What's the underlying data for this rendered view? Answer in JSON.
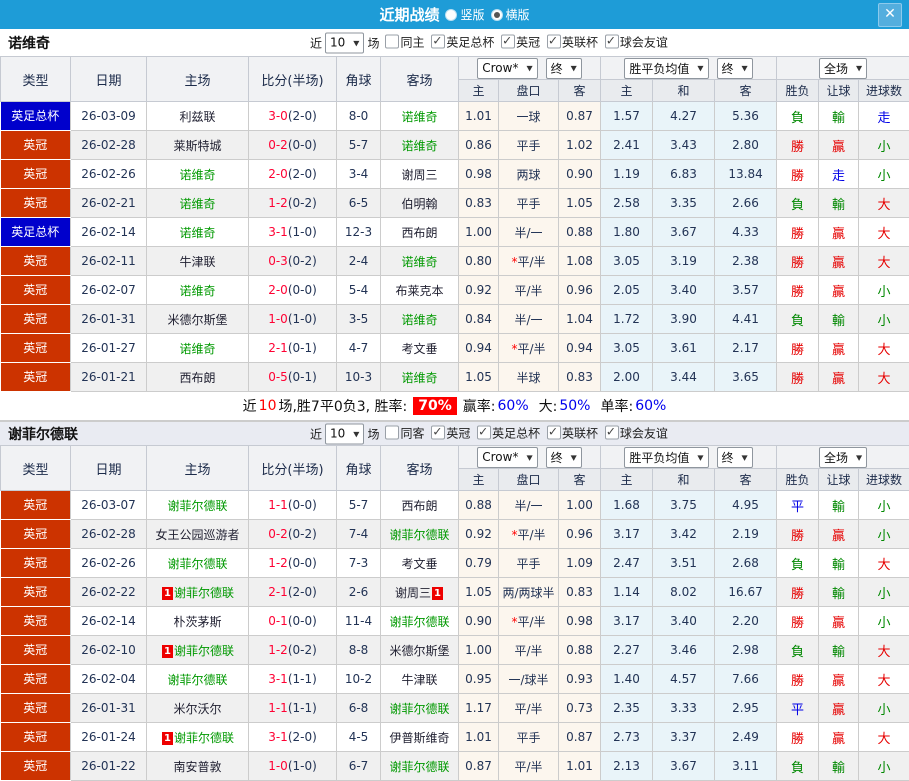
{
  "icons": {
    "close": "✕",
    "dropdown_arrow": "▼",
    "check": "✓"
  },
  "titlebar": {
    "title": "近期战绩",
    "layout_options": [
      {
        "label": "竖版",
        "selected": false
      },
      {
        "label": "横版",
        "selected": true
      }
    ]
  },
  "table_header": {
    "main_cols": [
      "类型",
      "日期",
      "主场",
      "比分(半场)",
      "角球",
      "客场"
    ],
    "sub_cols": [
      "主",
      "盘口",
      "客",
      "主",
      "和",
      "客",
      "胜负",
      "让球",
      "进球数"
    ],
    "dropdowns": {
      "bookmaker": "Crow*",
      "final1": "终",
      "avg": "胜平负均值",
      "final2": "终",
      "scope": "全场"
    }
  },
  "filter_common": {
    "near_label": "近",
    "count_value": "10",
    "games_label": "场"
  },
  "league_colors": {
    "英冠": "#cc3300",
    "英足总杯": "#0000cc"
  },
  "result_colors": {
    "勝": "#e60000",
    "贏": "#e60000",
    "大": "#e60000",
    "負": "#008800",
    "輸": "#008800",
    "小": "#008800",
    "平": "#0000e6",
    "走": "#0000e6"
  },
  "tables": [
    {
      "team": "诺维奇",
      "filter_checkboxes": [
        {
          "label": "同主",
          "checked": false
        },
        {
          "label": "英足总杯",
          "checked": true
        },
        {
          "label": "英冠",
          "checked": true
        },
        {
          "label": "英联杯",
          "checked": true
        },
        {
          "label": "球会友谊",
          "checked": true
        }
      ],
      "rows": [
        {
          "type": "英足总杯",
          "date": "26-03-09",
          "home": "利兹联",
          "score_ft": "3-0",
          "score_ht": "(2-0)",
          "corner": "8-0",
          "away": "诺维奇",
          "away_hl": true,
          "ah_home": "1.01",
          "ah_line": "一球",
          "ah_away": "0.87",
          "eu_home": "1.57",
          "eu_draw": "4.27",
          "eu_away": "5.36",
          "r_wdl": "負",
          "r_ah": "輸",
          "r_ou": "走"
        },
        {
          "type": "英冠",
          "date": "26-02-28",
          "home": "莱斯特城",
          "score_ft": "0-2",
          "score_ht": "(0-0)",
          "corner": "5-7",
          "away": "诺维奇",
          "away_hl": true,
          "ah_home": "0.86",
          "ah_line": "平手",
          "ah_away": "1.02",
          "eu_home": "2.41",
          "eu_draw": "3.43",
          "eu_away": "2.80",
          "r_wdl": "勝",
          "r_ah": "贏",
          "r_ou": "小"
        },
        {
          "type": "英冠",
          "date": "26-02-26",
          "home": "诺维奇",
          "home_hl": true,
          "score_ft": "2-0",
          "score_ht": "(2-0)",
          "corner": "3-4",
          "away": "谢周三",
          "ah_home": "0.98",
          "ah_line": "两球",
          "ah_away": "0.90",
          "eu_home": "1.19",
          "eu_draw": "6.83",
          "eu_away": "13.84",
          "r_wdl": "勝",
          "r_ah": "走",
          "r_ou": "小"
        },
        {
          "type": "英冠",
          "date": "26-02-21",
          "home": "诺维奇",
          "home_hl": true,
          "score_ft": "1-2",
          "score_ht": "(0-2)",
          "corner": "6-5",
          "away": "伯明翰",
          "ah_home": "0.83",
          "ah_line": "平手",
          "ah_away": "1.05",
          "eu_home": "2.58",
          "eu_draw": "3.35",
          "eu_away": "2.66",
          "r_wdl": "負",
          "r_ah": "輸",
          "r_ou": "大"
        },
        {
          "type": "英足总杯",
          "date": "26-02-14",
          "home": "诺维奇",
          "home_hl": true,
          "score_ft": "3-1",
          "score_ht": "(1-0)",
          "corner": "12-3",
          "away": "西布朗",
          "ah_home": "1.00",
          "ah_line": "半/一",
          "ah_away": "0.88",
          "eu_home": "1.80",
          "eu_draw": "3.67",
          "eu_away": "4.33",
          "r_wdl": "勝",
          "r_ah": "贏",
          "r_ou": "大"
        },
        {
          "type": "英冠",
          "date": "26-02-11",
          "home": "牛津联",
          "score_ft": "0-3",
          "score_ht": "(0-2)",
          "corner": "2-4",
          "away": "诺维奇",
          "away_hl": true,
          "ah_home": "0.80",
          "ah_line": "*平/半",
          "ah_away": "1.08",
          "eu_home": "3.05",
          "eu_draw": "3.19",
          "eu_away": "2.38",
          "r_wdl": "勝",
          "r_ah": "贏",
          "r_ou": "大"
        },
        {
          "type": "英冠",
          "date": "26-02-07",
          "home": "诺维奇",
          "home_hl": true,
          "score_ft": "2-0",
          "score_ht": "(0-0)",
          "corner": "5-4",
          "away": "布莱克本",
          "ah_home": "0.92",
          "ah_line": "平/半",
          "ah_away": "0.96",
          "eu_home": "2.05",
          "eu_draw": "3.40",
          "eu_away": "3.57",
          "r_wdl": "勝",
          "r_ah": "贏",
          "r_ou": "小"
        },
        {
          "type": "英冠",
          "date": "26-01-31",
          "home": "米德尔斯堡",
          "score_ft": "1-0",
          "score_ht": "(1-0)",
          "corner": "3-5",
          "away": "诺维奇",
          "away_hl": true,
          "ah_home": "0.84",
          "ah_line": "半/一",
          "ah_away": "1.04",
          "eu_home": "1.72",
          "eu_draw": "3.90",
          "eu_away": "4.41",
          "r_wdl": "負",
          "r_ah": "輸",
          "r_ou": "小"
        },
        {
          "type": "英冠",
          "date": "26-01-27",
          "home": "诺维奇",
          "home_hl": true,
          "score_ft": "2-1",
          "score_ht": "(0-1)",
          "corner": "4-7",
          "away": "考文垂",
          "ah_home": "0.94",
          "ah_line": "*平/半",
          "ah_away": "0.94",
          "eu_home": "3.05",
          "eu_draw": "3.61",
          "eu_away": "2.17",
          "r_wdl": "勝",
          "r_ah": "贏",
          "r_ou": "大"
        },
        {
          "type": "英冠",
          "date": "26-01-21",
          "home": "西布朗",
          "score_ft": "0-5",
          "score_ht": "(0-1)",
          "corner": "10-3",
          "away": "诺维奇",
          "away_hl": true,
          "ah_home": "1.05",
          "ah_line": "半球",
          "ah_away": "0.83",
          "eu_home": "2.00",
          "eu_draw": "3.44",
          "eu_away": "3.65",
          "r_wdl": "勝",
          "r_ah": "贏",
          "r_ou": "大"
        }
      ],
      "summary": {
        "lead1": "近",
        "lead_count": "10",
        "lead2": "场,胜7平0负3, 胜率:",
        "win_rate": "70%",
        "seg1_label": "赢率:",
        "seg1_value": "60%",
        "seg2_label": "大:",
        "seg2_value": "50%",
        "seg3_label": "单率:",
        "seg3_value": "60%"
      }
    },
    {
      "team": "谢菲尔德联",
      "filter_checkboxes": [
        {
          "label": "同客",
          "checked": false
        },
        {
          "label": "英冠",
          "checked": true
        },
        {
          "label": "英足总杯",
          "checked": true
        },
        {
          "label": "英联杯",
          "checked": true
        },
        {
          "label": "球会友谊",
          "checked": true
        }
      ],
      "rows": [
        {
          "type": "英冠",
          "date": "26-03-07",
          "home": "谢菲尔德联",
          "home_hl": true,
          "score_ft": "1-1",
          "score_ht": "(0-0)",
          "corner": "5-7",
          "away": "西布朗",
          "ah_home": "0.88",
          "ah_line": "半/一",
          "ah_away": "1.00",
          "eu_home": "1.68",
          "eu_draw": "3.75",
          "eu_away": "4.95",
          "r_wdl": "平",
          "r_ah": "輸",
          "r_ou": "小"
        },
        {
          "type": "英冠",
          "date": "26-02-28",
          "home": "女王公园巡游者",
          "score_ft": "0-2",
          "score_ht": "(0-2)",
          "corner": "7-4",
          "away": "谢菲尔德联",
          "away_hl": true,
          "ah_home": "0.92",
          "ah_line": "*平/半",
          "ah_away": "0.96",
          "eu_home": "3.17",
          "eu_draw": "3.42",
          "eu_away": "2.19",
          "r_wdl": "勝",
          "r_ah": "贏",
          "r_ou": "小"
        },
        {
          "type": "英冠",
          "date": "26-02-26",
          "home": "谢菲尔德联",
          "home_hl": true,
          "score_ft": "1-2",
          "score_ht": "(0-0)",
          "corner": "7-3",
          "away": "考文垂",
          "ah_home": "0.79",
          "ah_line": "平手",
          "ah_away": "1.09",
          "eu_home": "2.47",
          "eu_draw": "3.51",
          "eu_away": "2.68",
          "r_wdl": "負",
          "r_ah": "輸",
          "r_ou": "大"
        },
        {
          "type": "英冠",
          "date": "26-02-22",
          "home": "谢菲尔德联",
          "home_hl": true,
          "home_rc": "1",
          "score_ft": "2-1",
          "score_ht": "(2-0)",
          "corner": "2-6",
          "away": "谢周三",
          "away_rc": "1",
          "ah_home": "1.05",
          "ah_line": "两/两球半",
          "ah_away": "0.83",
          "eu_home": "1.14",
          "eu_draw": "8.02",
          "eu_away": "16.67",
          "r_wdl": "勝",
          "r_ah": "輸",
          "r_ou": "小"
        },
        {
          "type": "英冠",
          "date": "26-02-14",
          "home": "朴茨茅斯",
          "score_ft": "0-1",
          "score_ht": "(0-0)",
          "corner": "11-4",
          "away": "谢菲尔德联",
          "away_hl": true,
          "ah_home": "0.90",
          "ah_line": "*平/半",
          "ah_away": "0.98",
          "eu_home": "3.17",
          "eu_draw": "3.40",
          "eu_away": "2.20",
          "r_wdl": "勝",
          "r_ah": "贏",
          "r_ou": "小"
        },
        {
          "type": "英冠",
          "date": "26-02-10",
          "home": "谢菲尔德联",
          "home_hl": true,
          "home_rc": "1",
          "score_ft": "1-2",
          "score_ht": "(0-2)",
          "corner": "8-8",
          "away": "米德尔斯堡",
          "ah_home": "1.00",
          "ah_line": "平/半",
          "ah_away": "0.88",
          "eu_home": "2.27",
          "eu_draw": "3.46",
          "eu_away": "2.98",
          "r_wdl": "負",
          "r_ah": "輸",
          "r_ou": "大"
        },
        {
          "type": "英冠",
          "date": "26-02-04",
          "home": "谢菲尔德联",
          "home_hl": true,
          "score_ft": "3-1",
          "score_ht": "(1-1)",
          "corner": "10-2",
          "away": "牛津联",
          "ah_home": "0.95",
          "ah_line": "一/球半",
          "ah_away": "0.93",
          "eu_home": "1.40",
          "eu_draw": "4.57",
          "eu_away": "7.66",
          "r_wdl": "勝",
          "r_ah": "贏",
          "r_ou": "大"
        },
        {
          "type": "英冠",
          "date": "26-01-31",
          "home": "米尔沃尔",
          "score_ft": "1-1",
          "score_ht": "(1-1)",
          "corner": "6-8",
          "away": "谢菲尔德联",
          "away_hl": true,
          "ah_home": "1.17",
          "ah_line": "平/半",
          "ah_away": "0.73",
          "eu_home": "2.35",
          "eu_draw": "3.33",
          "eu_away": "2.95",
          "r_wdl": "平",
          "r_ah": "贏",
          "r_ou": "小"
        },
        {
          "type": "英冠",
          "date": "26-01-24",
          "home": "谢菲尔德联",
          "home_hl": true,
          "home_rc": "1",
          "score_ft": "3-1",
          "score_ht": "(2-0)",
          "corner": "4-5",
          "away": "伊普斯维奇",
          "ah_home": "1.01",
          "ah_line": "平手",
          "ah_away": "0.87",
          "eu_home": "2.73",
          "eu_draw": "3.37",
          "eu_away": "2.49",
          "r_wdl": "勝",
          "r_ah": "贏",
          "r_ou": "大"
        },
        {
          "type": "英冠",
          "date": "26-01-22",
          "home": "南安普敦",
          "score_ft": "1-0",
          "score_ht": "(1-0)",
          "corner": "6-7",
          "away": "谢菲尔德联",
          "away_hl": true,
          "ah_home": "0.87",
          "ah_line": "平/半",
          "ah_away": "1.01",
          "eu_home": "2.13",
          "eu_draw": "3.67",
          "eu_away": "3.11",
          "r_wdl": "負",
          "r_ah": "輸",
          "r_ou": "小"
        }
      ]
    }
  ]
}
